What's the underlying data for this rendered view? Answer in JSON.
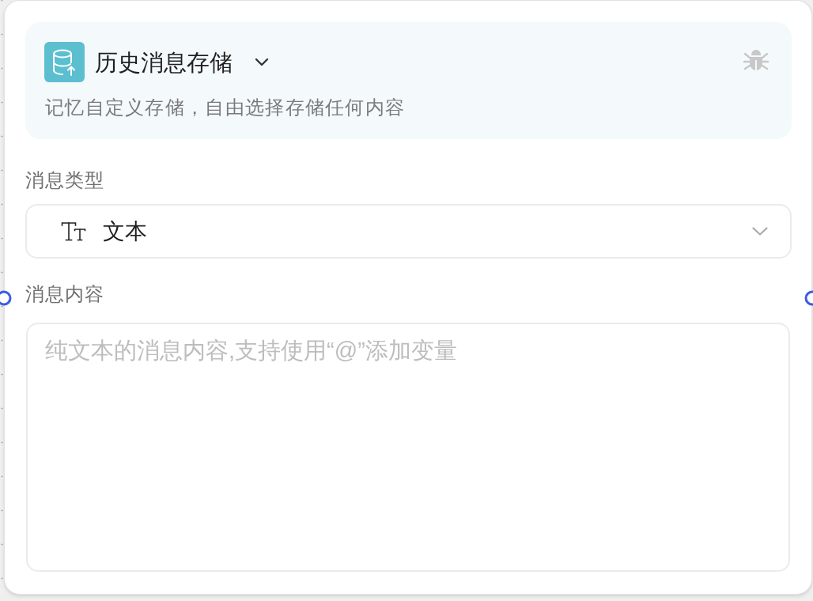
{
  "node": {
    "title": "历史消息存储",
    "description": "记忆自定义存储，自由选择存储任何内容"
  },
  "fields": [
    {
      "kind": "select",
      "label": "消息类型",
      "value": "文本"
    },
    {
      "kind": "textarea",
      "label": "消息内容",
      "placeholder": "纯文本的消息内容,支持使用“@”添加变量"
    }
  ]
}
